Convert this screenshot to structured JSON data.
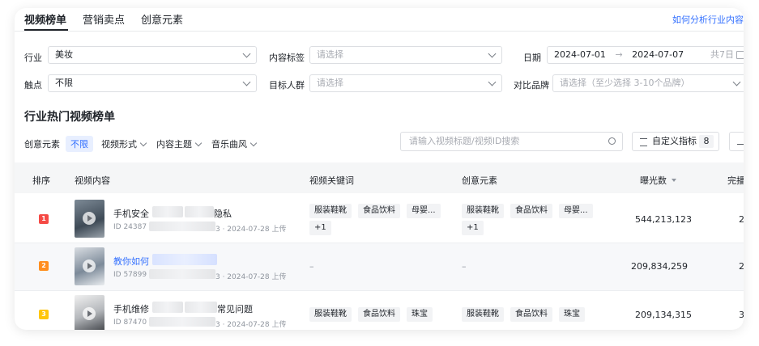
{
  "tabs": [
    "视频榜单",
    "营销卖点",
    "创意元素"
  ],
  "help_link": "如何分析行业内容",
  "filters": {
    "industry_label": "行业",
    "industry_value": "美妆",
    "content_tag_label": "内容标签",
    "content_tag_placeholder": "请选择",
    "date_label": "日期",
    "date_start": "2024-07-01",
    "date_arrow": "→",
    "date_end": "2024-07-07",
    "date_days": "共7日",
    "touch_label": "触点",
    "touch_value": "不限",
    "audience_label": "目标人群",
    "audience_placeholder": "请选择",
    "brand_label": "对比品牌",
    "brand_placeholder": "请选择（至少选择 3-10个品牌）"
  },
  "section_title": "行业热门视频榜单",
  "sub_filters": {
    "creative_label": "创意元素",
    "creative_value": "不限",
    "video_form": "视频形式",
    "content_theme": "内容主题",
    "music_style": "音乐曲风"
  },
  "search_placeholder": "请输入视频标题/视频ID搜索",
  "custom_metrics": {
    "label": "自定义指标",
    "count": "8"
  },
  "icons": [
    "search-icon",
    "filter-icon",
    "download-icon",
    "calendar-icon",
    "play-icon",
    "sort-icon"
  ],
  "columns": [
    "排序",
    "视频内容",
    "视频关键词",
    "创意元素",
    "曝光数",
    "完播"
  ],
  "rows": [
    {
      "rank": "1",
      "rank_color": "#f54a45",
      "title_a": "手机安全",
      "title_b": "隐私",
      "id_a": "ID 24387",
      "id_b": "3 · 2024-07-28 上传",
      "keywords": [
        "服装鞋靴",
        "食品饮料",
        "母婴...",
        "+1"
      ],
      "elements": [
        "服装鞋靴",
        "食品饮料",
        "母婴...",
        "+1"
      ],
      "exposure": "544,213,123",
      "finish": "2"
    },
    {
      "rank": "2",
      "rank_color": "#ff8f1f",
      "title_a": "教你如何",
      "title_b": "",
      "id_a": "ID 57899",
      "id_b": "3 · 2024-07-28 上传",
      "keywords_empty": "–",
      "elements_empty": "–",
      "exposure": "209,834,259",
      "finish": "2"
    },
    {
      "rank": "3",
      "rank_color": "#ffc60a",
      "title_a": "手机维修",
      "title_b": "常见问题",
      "id_a": "ID 87470",
      "id_b": "3 · 2024-07-28 上传",
      "keywords": [
        "服装鞋靴",
        "食品饮料",
        "珠宝"
      ],
      "elements": [
        "服装鞋靴",
        "食品饮料",
        "珠宝"
      ],
      "exposure": "209,134,315",
      "finish": "3"
    }
  ],
  "colors": {
    "accent": "#3370ff",
    "rank1": "#f54a45",
    "rank2": "#ff8f1f",
    "rank3": "#ffc60a"
  }
}
